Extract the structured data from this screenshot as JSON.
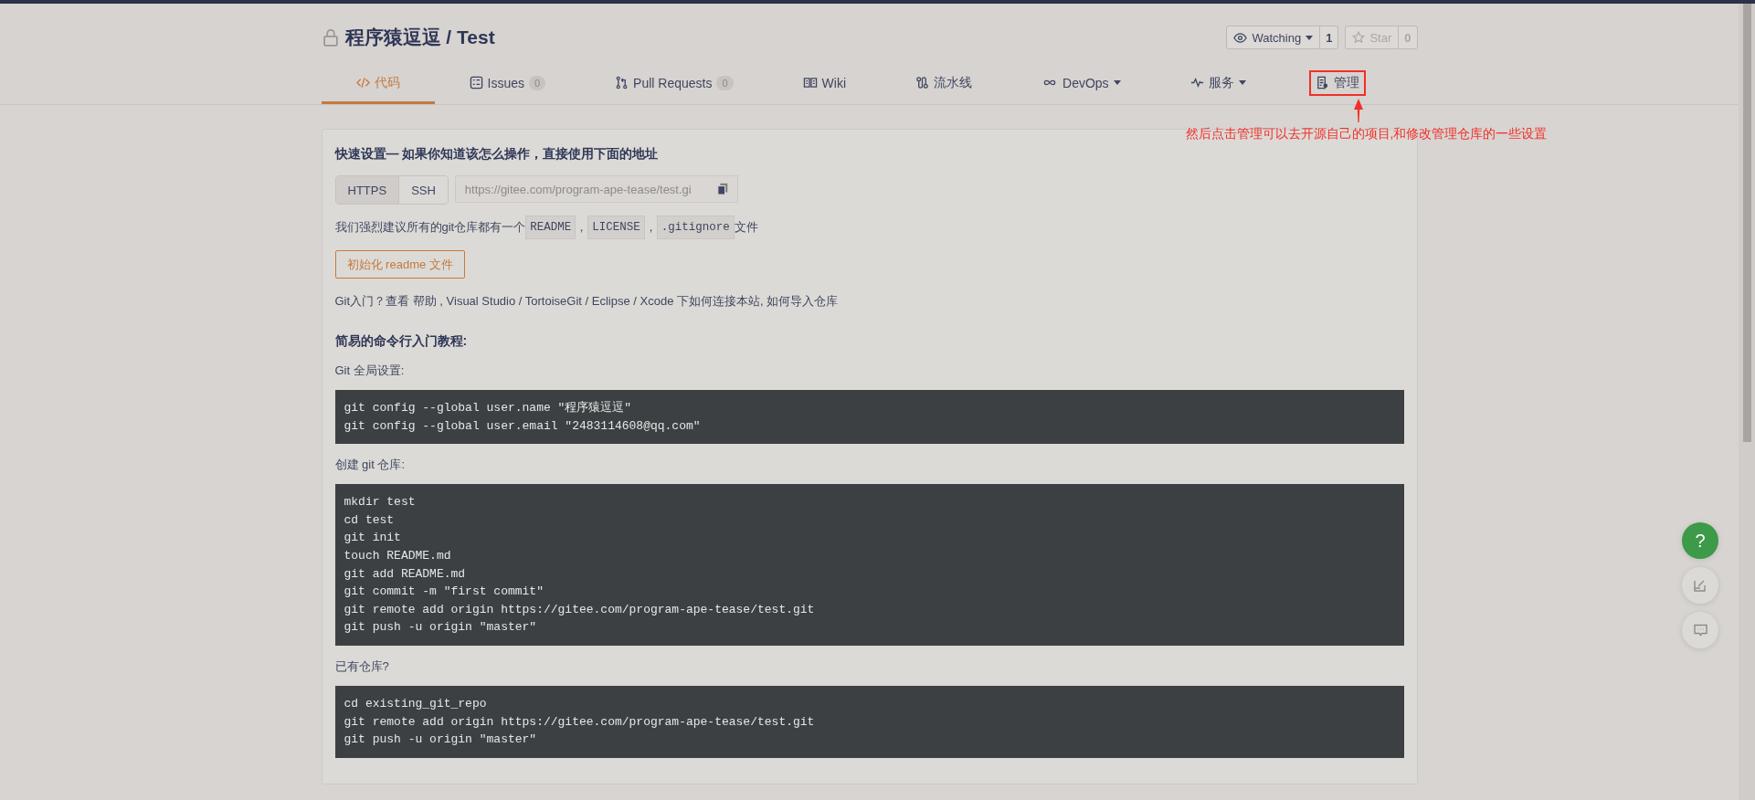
{
  "repo": {
    "title": "程序猿逗逗 / Test",
    "private": true
  },
  "watch": {
    "label": "Watching",
    "count": "1"
  },
  "star": {
    "label": "Star",
    "count": "0",
    "disabled": true
  },
  "tabs": [
    {
      "label": "代码",
      "selected": true,
      "annotated": false
    },
    {
      "label": "Issues",
      "count": "0",
      "selected": false,
      "annotated": false
    },
    {
      "label": "Pull Requests",
      "count": "0",
      "selected": false,
      "annotated": false
    },
    {
      "label": "Wiki",
      "selected": false,
      "annotated": false
    },
    {
      "label": "流水线",
      "selected": false,
      "annotated": false
    },
    {
      "label": "DevOps",
      "dropdown": true,
      "selected": false,
      "annotated": false
    },
    {
      "label": "服务",
      "dropdown": true,
      "selected": false,
      "annotated": false
    },
    {
      "label": "管理",
      "selected": false,
      "annotated": true
    }
  ],
  "annotation": {
    "text": "然后点击管理可以去开源自己的项目,和修改管理仓库的一些设置"
  },
  "quick_setup": {
    "heading": "快速设置— 如果你知道该怎么操作，直接使用下面的地址",
    "protocols": [
      {
        "label": "HTTPS",
        "selected": true
      },
      {
        "label": "SSH",
        "selected": false
      }
    ],
    "url": "https://gitee.com/program-ape-tease/test.gi",
    "recommendation": [
      {
        "kind": "text",
        "text": "我们强烈建议所有的git仓库都有一个"
      },
      {
        "kind": "code",
        "text": "README"
      },
      {
        "kind": "text",
        "text": "，"
      },
      {
        "kind": "code",
        "text": "LICENSE"
      },
      {
        "kind": "text",
        "text": "，"
      },
      {
        "kind": "code",
        "text": ".gitignore"
      },
      {
        "kind": "text",
        "text": "文件"
      }
    ],
    "init_button": "初始化 readme 文件",
    "help": "Git入门？查看 帮助 , Visual Studio / TortoiseGit / Eclipse / Xcode 下如何连接本站, 如何导入仓库"
  },
  "tutorial": {
    "heading": "简易的命令行入门教程:",
    "sections": [
      {
        "label": "Git 全局设置:",
        "lines": [
          "git config --global user.name \"程序猿逗逗\"",
          "git config --global user.email \"2483114608@qq.com\""
        ]
      },
      {
        "label": "创建 git 仓库:",
        "lines": [
          "mkdir test",
          "cd test",
          "git init",
          "touch README.md",
          "git add README.md",
          "git commit -m \"first commit\"",
          "git remote add origin https://gitee.com/program-ape-tease/test.git",
          "git push -u origin \"master\""
        ]
      },
      {
        "label": "已有仓库?",
        "lines": [
          "cd existing_git_repo",
          "git remote add origin https://gitee.com/program-ape-tease/test.git",
          "git push -u origin \"master\""
        ]
      }
    ]
  },
  "help_button": "?"
}
